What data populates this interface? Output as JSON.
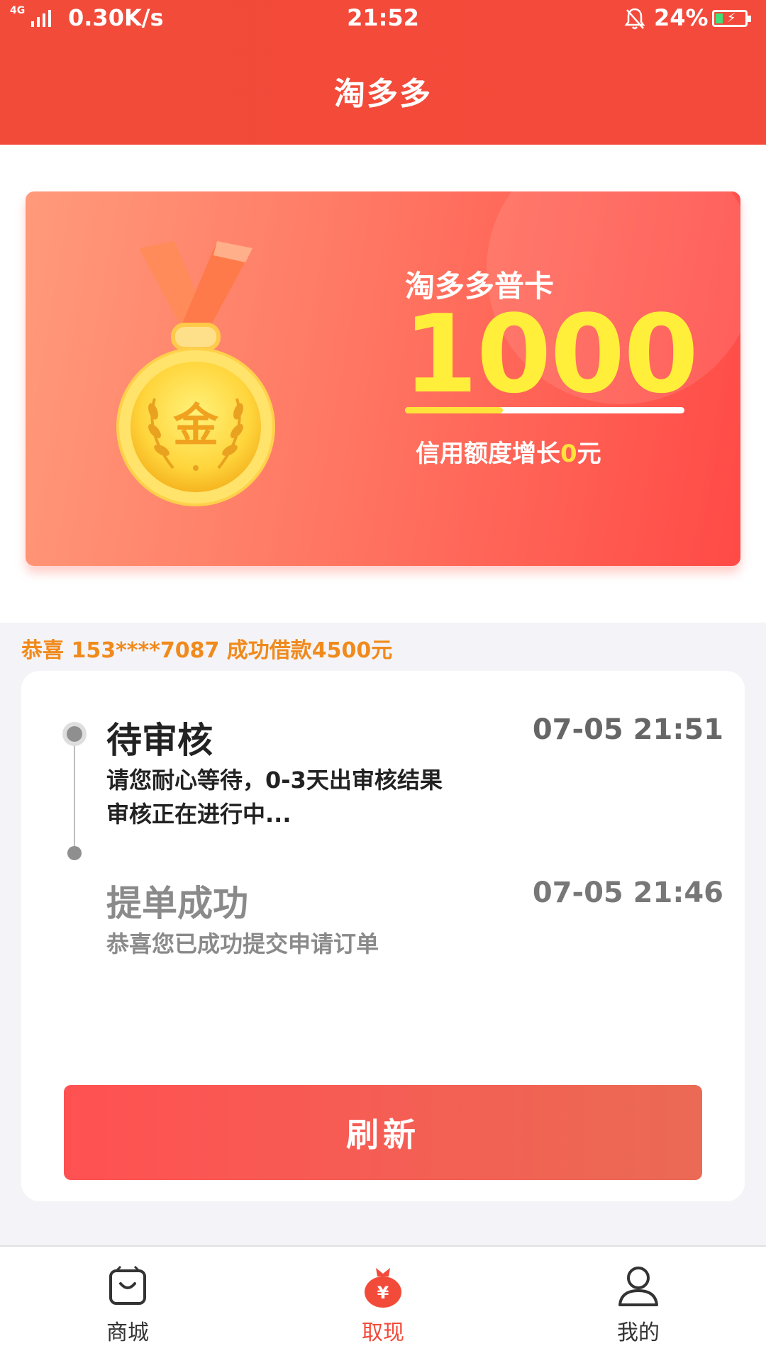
{
  "status_bar": {
    "network": "4G",
    "speed": "0.30K/s",
    "time": "21:52",
    "battery_percent": "24%",
    "battery_level": 0.24
  },
  "header": {
    "title": "淘多多"
  },
  "card": {
    "product_name": "淘多多普卡",
    "amount": "1000",
    "medal_label": "金",
    "progress_fraction": 0.35,
    "growth_prefix": "信用额度增长",
    "growth_value": "0",
    "growth_suffix": "元"
  },
  "ticker": {
    "text": "恭喜 153****7087 成功借款4500元"
  },
  "timeline": [
    {
      "title": "待审核",
      "time": "07-05  21:51",
      "lines": [
        "请您耐心等待，0-3天出审核结果",
        "审核正在进行中..."
      ]
    },
    {
      "title": "提单成功",
      "time": "07-05 21:46",
      "lines": [
        "恭喜您已成功提交申请订单"
      ]
    }
  ],
  "refresh_button": {
    "label": "刷新"
  },
  "bottom_nav": [
    {
      "label": "商城",
      "icon": "shopping-bag-icon",
      "active": false
    },
    {
      "label": "取现",
      "icon": "money-bag-icon",
      "active": true
    },
    {
      "label": "我的",
      "icon": "user-icon",
      "active": false
    }
  ],
  "colors": {
    "primary": "#f24b3a",
    "accent_yellow": "#ffee3a",
    "ticker": "#f08a1c",
    "nav_active": "#f24b3a",
    "nav_inactive": "#333333"
  }
}
